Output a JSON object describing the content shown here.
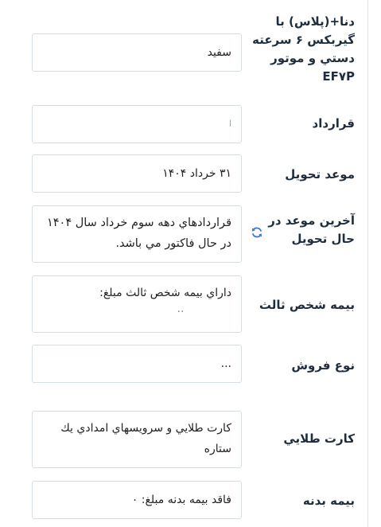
{
  "rows": [
    {
      "label": "دنا+(پلاس) با گیربکس ۶ سرعته دستي و موتور EF۷P",
      "value": "سفيد"
    },
    {
      "label": "قرارداد",
      "value": "ا"
    },
    {
      "label": "موعد تحويل",
      "value": "۳۱ خرداد ۱۴۰۴"
    },
    {
      "label": "آخرين موعد در حال تحويل",
      "value": "قراردادهاي دهه سوم خرداد سال ۱۴۰۴ در حال فاکتور مي باشد."
    },
    {
      "label": "بيمه شخص ثالث",
      "value": "داراي بيمه شخص ثالث مبلغ:",
      "extra": ".."
    },
    {
      "label": "نوع فروش",
      "value": "..."
    },
    {
      "label": "کارت طلايي",
      "value": "کارت طلايي و سرويسهاي امدادي يك ستاره"
    },
    {
      "label": "بيمه بدنه",
      "value": "فاقد بيمه بدنه مبلغ: ۰"
    }
  ],
  "icons": {
    "sync": "refresh-icon"
  },
  "colors": {
    "label": "#1f2d3d",
    "border": "#d7dde4",
    "icon": "#3a7bd5"
  }
}
